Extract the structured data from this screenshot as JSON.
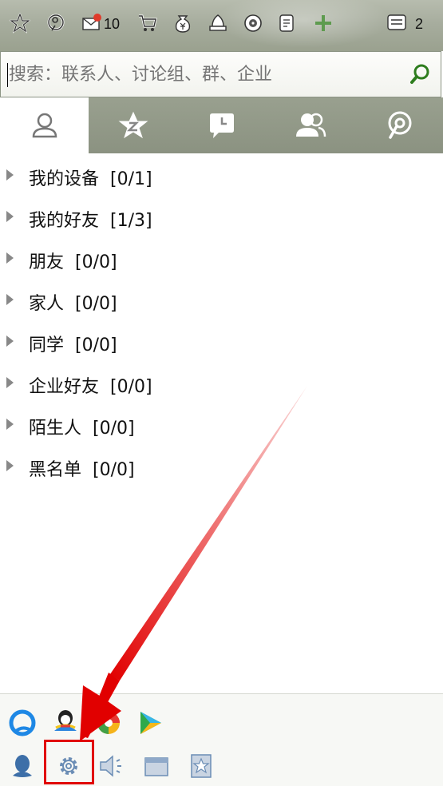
{
  "toolbar": {
    "mail_count": "10",
    "msg_count": "2",
    "icons": [
      "star-icon",
      "zone-icon",
      "mail-icon",
      "cart-icon",
      "money-bag-icon",
      "bell-icon",
      "music-icon",
      "doc-icon",
      "plus-icon",
      "message-box-icon"
    ]
  },
  "search": {
    "placeholder": "搜索：联系人、讨论组、群、企业"
  },
  "tabs": [
    {
      "name": "contacts",
      "icon": "person-icon",
      "active": true
    },
    {
      "name": "favorites",
      "icon": "star-z-icon",
      "active": false
    },
    {
      "name": "recent",
      "icon": "chat-clock-icon",
      "active": false
    },
    {
      "name": "groups",
      "icon": "group-icon",
      "active": false
    },
    {
      "name": "zone",
      "icon": "zone-icon",
      "active": false
    }
  ],
  "groups": [
    {
      "label": "我的设备",
      "count": "[0/1]"
    },
    {
      "label": "我的好友",
      "count": "[1/3]"
    },
    {
      "label": "朋友",
      "count": "[0/0]"
    },
    {
      "label": "家人",
      "count": "[0/0]"
    },
    {
      "label": "同学",
      "count": "[0/0]"
    },
    {
      "label": "企业好友",
      "count": "[0/0]"
    },
    {
      "label": "陌生人",
      "count": "[0/0]"
    },
    {
      "label": "黑名单",
      "count": "[0/0]"
    }
  ],
  "colors": {
    "highlight": "#e10000",
    "arrow": "#e10000",
    "toolbar_bg": "#a7ad9e",
    "search_icon": "#2e7d1e"
  }
}
